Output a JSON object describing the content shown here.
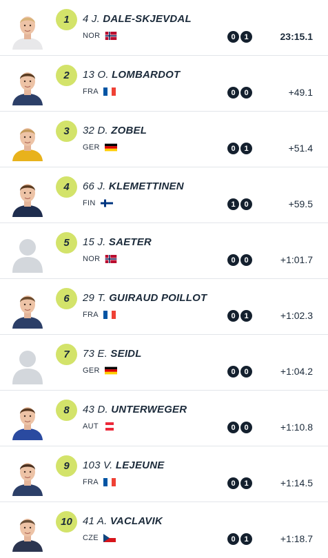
{
  "results": [
    {
      "rank": "1",
      "bib": "4 J.",
      "last": "DALE-SKJEVDAL",
      "nation": "NOR",
      "flag": "nor",
      "shoot": [
        "0",
        "1"
      ],
      "time": "23:15.1",
      "avatar": "photo",
      "jersey": "#e8e8ea",
      "hair": "#d9b37a"
    },
    {
      "rank": "2",
      "bib": "13 O.",
      "last": "LOMBARDOT",
      "nation": "FRA",
      "flag": "fra",
      "shoot": [
        "0",
        "0"
      ],
      "time": "+49.1",
      "avatar": "photo",
      "jersey": "#2c3f68",
      "hair": "#5a3c22"
    },
    {
      "rank": "3",
      "bib": "32 D.",
      "last": "ZOBEL",
      "nation": "GER",
      "flag": "ger",
      "shoot": [
        "0",
        "1"
      ],
      "time": "+51.4",
      "avatar": "photo",
      "jersey": "#e8b21c",
      "hair": "#c49a5c"
    },
    {
      "rank": "4",
      "bib": "66 J.",
      "last": "KLEMETTINEN",
      "nation": "FIN",
      "flag": "fin",
      "shoot": [
        "1",
        "0"
      ],
      "time": "+59.5",
      "avatar": "photo",
      "jersey": "#1f2d4e",
      "hair": "#5a3a20"
    },
    {
      "rank": "5",
      "bib": "15 J.",
      "last": "SAETER",
      "nation": "NOR",
      "flag": "nor",
      "shoot": [
        "0",
        "0"
      ],
      "time": "+1:01.7",
      "avatar": "placeholder",
      "jersey": "#d3d7dc",
      "hair": "#d3d7dc"
    },
    {
      "rank": "6",
      "bib": "29 T.",
      "last": "GUIRAUD POILLOT",
      "nation": "FRA",
      "flag": "fra",
      "shoot": [
        "0",
        "1"
      ],
      "time": "+1:02.3",
      "avatar": "photo",
      "jersey": "#2c3f68",
      "hair": "#6b4a2c"
    },
    {
      "rank": "7",
      "bib": "73 E.",
      "last": "SEIDL",
      "nation": "GER",
      "flag": "ger",
      "shoot": [
        "0",
        "0"
      ],
      "time": "+1:04.2",
      "avatar": "placeholder",
      "jersey": "#d3d7dc",
      "hair": "#d3d7dc"
    },
    {
      "rank": "8",
      "bib": "43 D.",
      "last": "UNTERWEGER",
      "nation": "AUT",
      "flag": "aut",
      "shoot": [
        "0",
        "0"
      ],
      "time": "+1:10.8",
      "avatar": "photo",
      "jersey": "#2a4aa0",
      "hair": "#5a3a22"
    },
    {
      "rank": "9",
      "bib": "103 V.",
      "last": "LEJEUNE",
      "nation": "FRA",
      "flag": "fra",
      "shoot": [
        "0",
        "1"
      ],
      "time": "+1:14.5",
      "avatar": "photo",
      "jersey": "#2c3f68",
      "hair": "#4a3020"
    },
    {
      "rank": "10",
      "bib": "41 A.",
      "last": "VACLAVIK",
      "nation": "CZE",
      "flag": "cze",
      "shoot": [
        "0",
        "1"
      ],
      "time": "+1:18.7",
      "avatar": "photo",
      "jersey": "#2c3550",
      "hair": "#6a5038"
    }
  ],
  "colors": {
    "rank_badge": "#d3e36a",
    "shoot_badge": "#14202e",
    "text": "#1b2a3a",
    "divider": "#e2e5e9"
  }
}
